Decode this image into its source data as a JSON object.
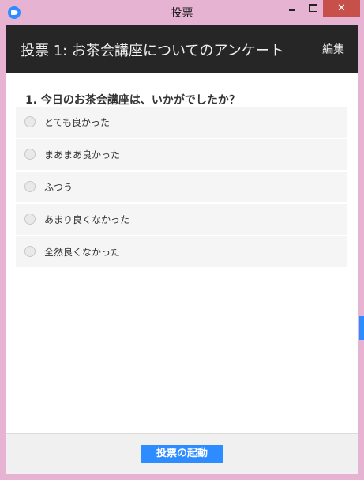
{
  "window": {
    "title": "投票"
  },
  "header": {
    "poll_title": "投票 1: お茶会講座についてのアンケート",
    "edit_label": "編集"
  },
  "question": {
    "text": "1. 今日のお茶会講座は、いかがでしたか？",
    "options": [
      {
        "label": "とても良かった"
      },
      {
        "label": "まあまあ良かった"
      },
      {
        "label": "ふつう"
      },
      {
        "label": "あまり良くなかった"
      },
      {
        "label": "全然良くなかった"
      }
    ]
  },
  "footer": {
    "launch_label": "投票の起動"
  },
  "colors": {
    "accent": "#2d8cff",
    "header_bg": "#262626",
    "window_frame": "#e6b3d3",
    "close_button": "#c7504a"
  }
}
